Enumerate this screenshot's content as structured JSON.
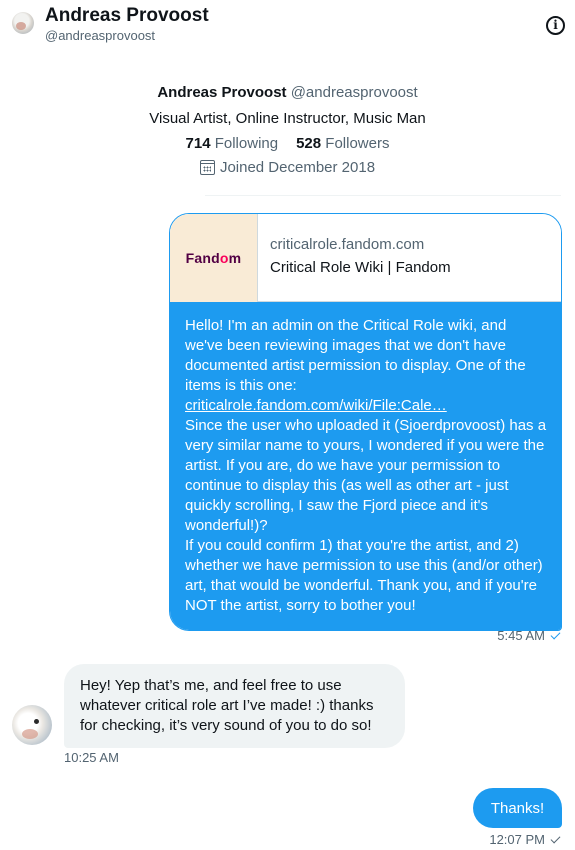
{
  "header": {
    "name": "Andreas Provoost",
    "handle": "@andreasprovoost",
    "info_icon": "info-icon"
  },
  "profile": {
    "name": "Andreas Provoost",
    "handle": "@andreasprovoost",
    "bio": "Visual Artist, Online Instructor, Music Man",
    "following_count": "714",
    "following_label": "Following",
    "followers_count": "528",
    "followers_label": "Followers",
    "joined": "Joined December 2018",
    "joined_icon": "calendar-icon"
  },
  "messages": {
    "outgoing_1": {
      "card": {
        "logo": "Fandom",
        "domain": "criticalrole.fandom.com",
        "title": "Critical Role Wiki | Fandom"
      },
      "text_intro": "Hello! I'm an admin on the Critical Role wiki, and we've been reviewing images that we don't have documented artist permission to display. One of the items is this one:",
      "link": "criticalrole.fandom.com/wiki/File:Cale…",
      "text_body": "Since the user who uploaded it (Sjoerdprovoost) has a very similar name to yours, I wondered if you were the artist. If you are, do we have your permission to continue to display this (as well as other art - just quickly scrolling, I saw the Fjord piece and it's wonderful!)?",
      "text_end": "If you could confirm 1) that you're the artist, and 2) whether we have permission to use this (and/or other) art, that would be wonderful. Thank you, and if you're NOT the artist, sorry to bother you!",
      "time": "5:45 AM"
    },
    "incoming_1": {
      "text": "Hey! Yep that’s me, and feel free to use whatever critical role art I’ve made! :) thanks for checking, it’s very sound of you to do so!",
      "time": "10:25 AM"
    },
    "outgoing_2": {
      "text": "Thanks!",
      "time": "12:07 PM"
    }
  },
  "colors": {
    "accent": "#1d9bf0",
    "incoming_bubble": "#eff3f4",
    "secondary_text": "#536471",
    "fandom_brand": "#520044",
    "fandom_flame": "#fa005a"
  }
}
